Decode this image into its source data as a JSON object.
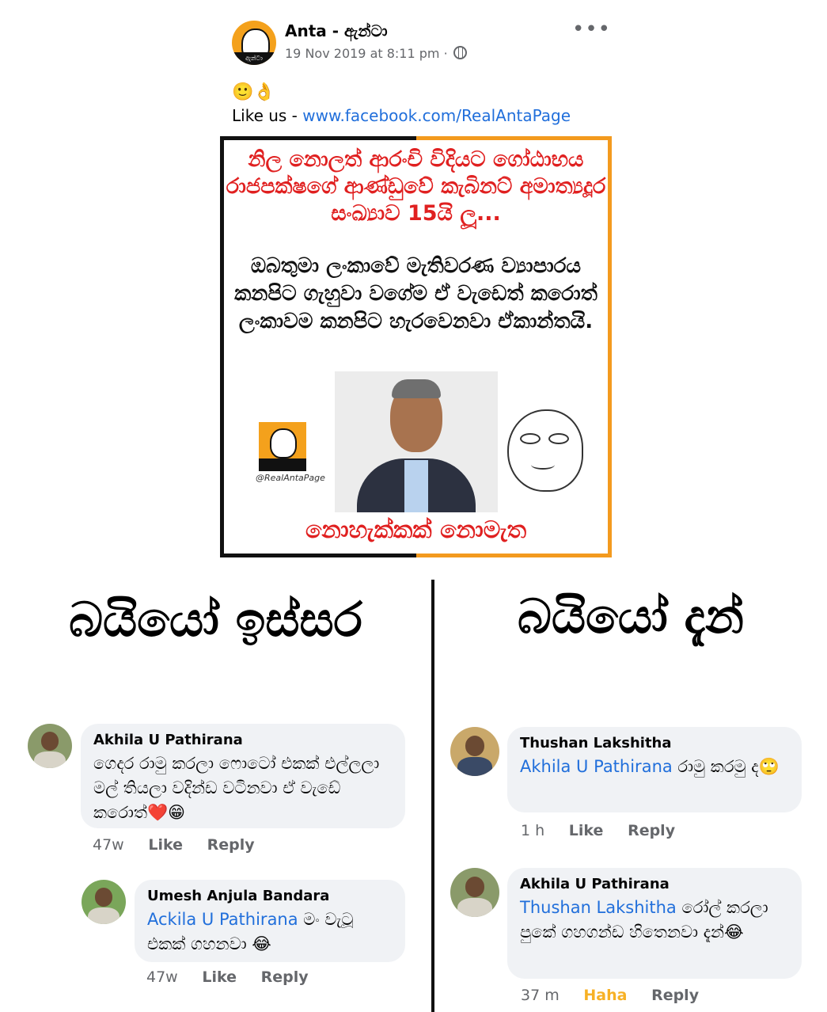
{
  "post": {
    "page_name": "Anta - ඇන්ටා",
    "timestamp": "19 Nov 2019 at 8:11 pm ·",
    "emojis": "🙂👌",
    "like_prefix": "Like us - ",
    "like_url": "www.facebook.com/RealAntaPage",
    "avatar_label": "ඇන්ටා"
  },
  "image": {
    "headline": "නිල නොලත් ආරංචි විදියට ගෝඨාභය රාජපක්ෂගේ ආණ්ඩුවේ කැබිනට් අමාත්‍යදූර සංඛ්‍යාව 15යි ලූ...",
    "body": "ඔබතුමා ලංකාවේ මැතිවරණ ව්‍යාපාරය කනපිට ගැහුවා වගේම ඒ වැඩෙත් කරොත් ලංකාවම කනපිට හැරවෙනවා ඒකාන්තයි.",
    "footer": "නොහැක්කක් නොමැත",
    "handle": "@RealAntaPage",
    "logo_label": "ඇන්ටා"
  },
  "compare": {
    "left_heading": "බයියෝ ඉස්සර",
    "right_heading": "බයියෝ දැන්"
  },
  "left_comments": [
    {
      "name": "Akhila U Pathirana",
      "mention": "",
      "text": "ගෙදර රාමු කරලා ෆොටෝ එකක් එල්ලලා මල් තියලා වදින්ඩ වටිනවා ඒ වැඩේ කරොත්❤️😁",
      "time": "47w",
      "like": "Like",
      "reply": "Reply"
    },
    {
      "name": "Umesh Anjula Bandara",
      "mention": "Ackila U Pathirana",
      "text": " මං වැටූ එකක් ගහනවා 😂",
      "time": "47w",
      "like": "Like",
      "reply": "Reply"
    }
  ],
  "right_comments": [
    {
      "name": "Thushan Lakshitha",
      "mention": "Akhila U Pathirana",
      "text": " රාමු කරමු ද🙄",
      "time": "1 h",
      "like": "Like",
      "reply": "Reply"
    },
    {
      "name": "Akhila U Pathirana",
      "mention": "Thushan Lakshitha",
      "text": " රෝල් කරලා පුකේ ගහගන්ඩ හිතෙනවා දැන්😂",
      "time": "37 m",
      "like": "Haha",
      "reply": "Reply"
    }
  ],
  "colors": {
    "link": "#216fdb",
    "red_text": "#e02020",
    "orange_border": "#f39a1e",
    "haha": "#f7b125",
    "bubble": "#f0f2f5"
  }
}
